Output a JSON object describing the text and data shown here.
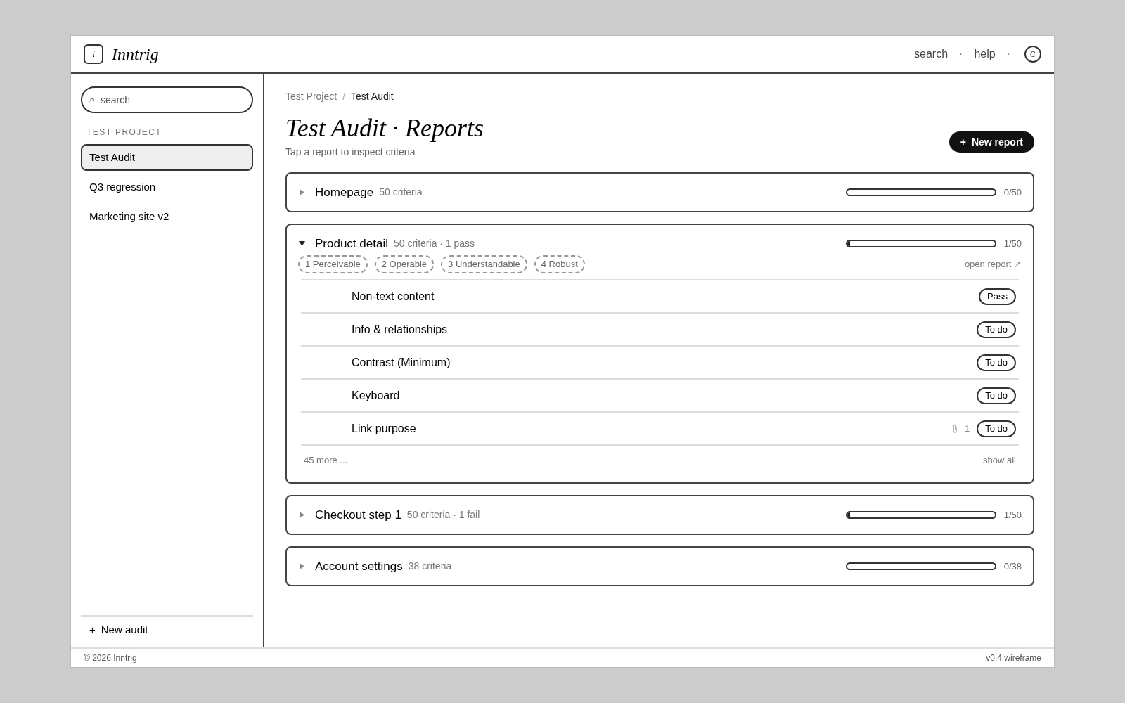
{
  "app": {
    "logo_glyph": "i",
    "name": "Inntrig"
  },
  "top_nav": {
    "links": [
      "search",
      "help"
    ],
    "separator": "·",
    "avatar": "C"
  },
  "sidebar": {
    "search": {
      "placeholder": "search",
      "icon": "⌕"
    },
    "section": "TEST PROJECT",
    "items": [
      {
        "label": "Test Audit",
        "selected": true
      },
      {
        "label": "Q3 regression",
        "selected": false
      },
      {
        "label": "Marketing site v2",
        "selected": false
      }
    ],
    "new_audit": {
      "icon": "+",
      "label": "New audit"
    }
  },
  "breadcrumb": {
    "items": [
      "Test Project",
      "Test Audit"
    ],
    "separator": "/"
  },
  "title": "Test Audit · Reports",
  "subtitle": "Tap a report to inspect criteria",
  "new_report": {
    "icon": "+",
    "label": "New report"
  },
  "reports": [
    {
      "name": "Homepage",
      "meta": "50 criteria",
      "level": 0,
      "count": "0/50",
      "expanded": false
    },
    {
      "name": "Product detail",
      "meta": "50 criteria · 1 pass",
      "level": 0.02,
      "count": "1/50",
      "expanded": true,
      "chips": [
        "1 Perceivable",
        "2 Operable",
        "3 Understandable",
        "4 Robust"
      ],
      "link": "open report ↗",
      "criteria": [
        {
          "name": "Non-text content",
          "status": "Pass"
        },
        {
          "name": "Info & relationships",
          "status": "To do"
        },
        {
          "name": "Contrast (Minimum)",
          "status": "To do"
        },
        {
          "name": "Keyboard",
          "status": "To do"
        },
        {
          "name": "Link purpose",
          "status": "To do",
          "attachments": "1"
        }
      ],
      "more": "45 more ...",
      "show_all": "show all"
    },
    {
      "name": "Checkout step 1",
      "meta": "50 criteria · 1 fail",
      "level": 0.02,
      "count": "1/50",
      "expanded": false
    },
    {
      "name": "Account settings",
      "meta": "38 criteria",
      "level": 0,
      "count": "0/38",
      "expanded": false
    }
  ],
  "footer": {
    "left": "© 2026 Inntrig",
    "right": "v0.4 wireframe"
  }
}
